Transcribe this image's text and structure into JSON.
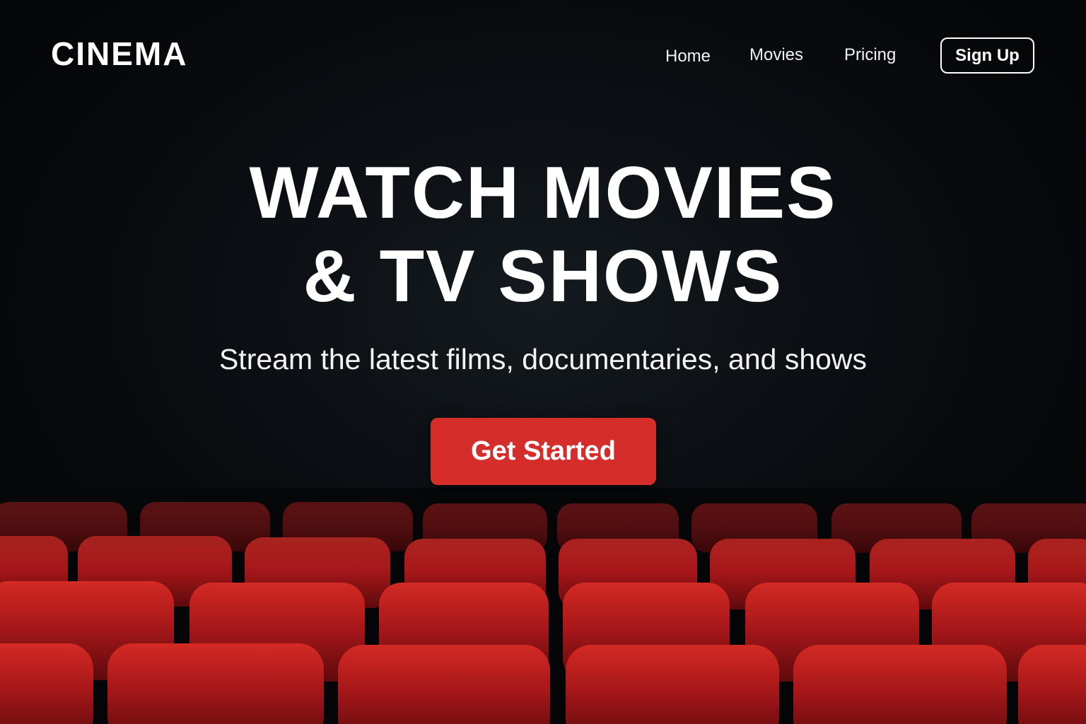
{
  "header": {
    "logo": "CINEMA",
    "nav": {
      "home": "Home",
      "movies": "Movies",
      "pricing": "Pricing"
    },
    "signup_label": "Sign Up"
  },
  "hero": {
    "title_line1": "WATCH MOVIES",
    "title_line2": "& TV SHOWS",
    "subtitle": "Stream the latest films, documentaries, and shows",
    "cta_label": "Get Started"
  },
  "colors": {
    "background": "#07090c",
    "accent": "#d52e2a",
    "seat_red": "#b31b1b",
    "text": "#ffffff"
  },
  "background_image": "theater-seats"
}
